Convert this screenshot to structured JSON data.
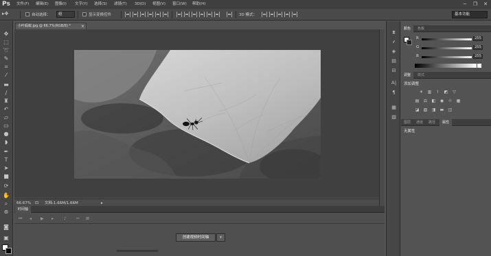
{
  "app": {
    "logo": "Ps",
    "menu": [
      "文件(F)",
      "编辑(E)",
      "图像(I)",
      "文字(Y)",
      "选择(S)",
      "滤镜(T)",
      "3D(D)",
      "视图(V)",
      "窗口(W)",
      "帮助(H)"
    ],
    "window_controls": {
      "minimize": "−",
      "restore": "❐",
      "close": "✕"
    }
  },
  "options": {
    "tool_glyph": "▸✥",
    "auto_select_label": "自动选择：",
    "auto_select_value": "组",
    "show_transform_label": "显示变换控件",
    "mode_3d_label": "3D 模式：",
    "workspace": "基本功能"
  },
  "document": {
    "tab_label": "小叶蚂蚁.jpg @ 66.7%(RGB/8) *",
    "close_glyph": "×",
    "zoom": "66.67%",
    "file_info": "文档:1.66M/1.66M"
  },
  "timeline": {
    "tab_label": "时间轴",
    "create_button": "创建视频时间轴",
    "dropdown_glyph": "▾"
  },
  "panels": {
    "color_tabs": [
      "颜色",
      "色板"
    ],
    "color_rows": [
      {
        "channel": "R",
        "value": "255"
      },
      {
        "channel": "G",
        "value": "255"
      },
      {
        "channel": "B",
        "value": "255"
      }
    ],
    "adjust_tabs": [
      "调整",
      "样式"
    ],
    "adjust_title": "添加调整",
    "bottom_tabs": [
      "图层",
      "通道",
      "路径",
      "属性"
    ],
    "properties_text": "无属性"
  }
}
